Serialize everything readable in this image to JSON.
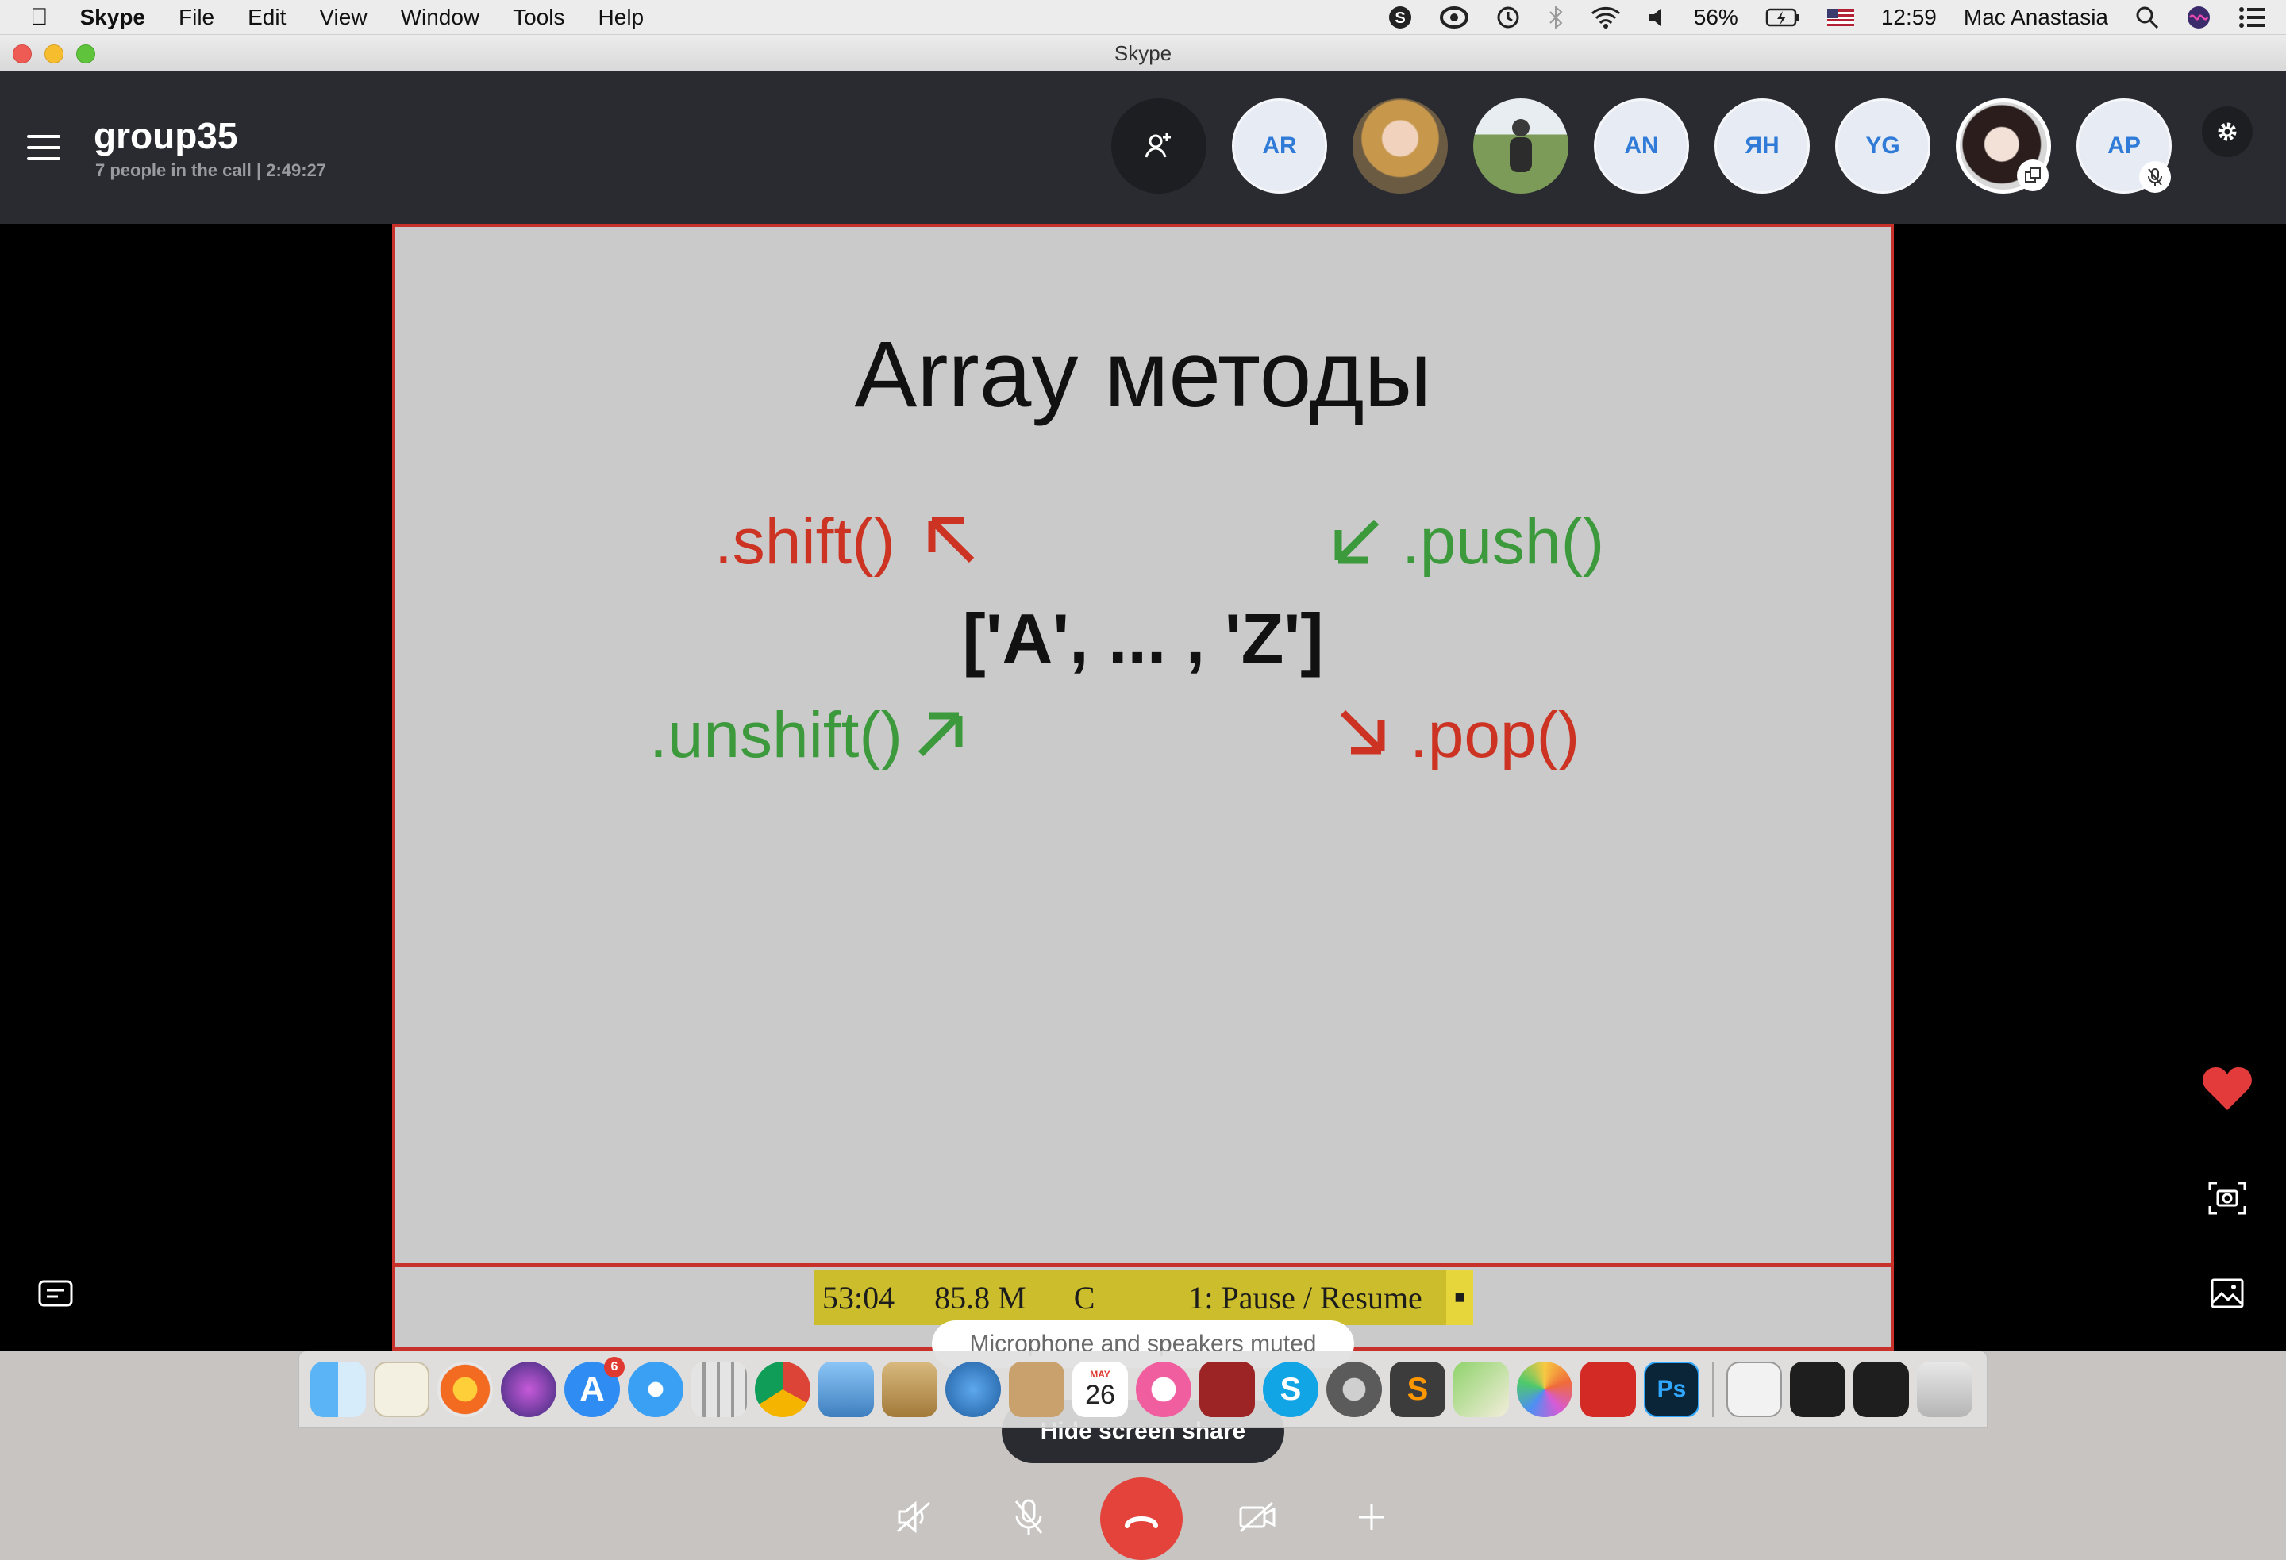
{
  "menubar": {
    "app_name": "Skype",
    "items": [
      "File",
      "Edit",
      "View",
      "Window",
      "Tools",
      "Help"
    ],
    "battery": "56%",
    "time": "12:59",
    "user": "Mac Anastasia"
  },
  "window": {
    "title": "Skype"
  },
  "call": {
    "group_name": "group35",
    "info": "7 people in the call | 2:49:27",
    "participants": [
      {
        "initials": "AR"
      },
      {
        "initials": ""
      },
      {
        "initials": ""
      },
      {
        "initials": "AN"
      },
      {
        "initials": "ЯН"
      },
      {
        "initials": "YG"
      },
      {
        "initials": ""
      },
      {
        "initials": "AP"
      }
    ]
  },
  "slide": {
    "title": "Array методы",
    "shift": ".shift()",
    "push": ".push()",
    "array": "['A', ... , 'Z']",
    "unshift": ".unshift()",
    "pop": ".pop()"
  },
  "recorder": {
    "text_left": "53:04",
    "text_size": "85.8 M",
    "text_c": "C",
    "text_right": "1: Pause / Resume"
  },
  "notifications": {
    "muted": "Microphone and speakers muted"
  },
  "buttons": {
    "hide_share": "Hide screen share"
  },
  "dock": {
    "apps": [
      "finder",
      "preview",
      "firefox",
      "siri",
      "app-store",
      "safari",
      "launchpad",
      "chrome",
      "mail",
      "files",
      "cyberduck",
      "contacts",
      "calendar",
      "itunes",
      "photo-booth",
      "skype",
      "system-preferences",
      "sublime-text",
      "maps",
      "photos",
      "creative-cloud",
      "photoshop"
    ],
    "app_store_badge": "6",
    "calendar_month": "MAY",
    "calendar_day": "26",
    "photoshop_label": "Ps"
  },
  "colors": {
    "header": "#2a2b30",
    "accent_red": "#cd3322",
    "accent_green": "#3c9a3c",
    "end_call": "#e4433b",
    "initials_text": "#2f7bd7"
  }
}
